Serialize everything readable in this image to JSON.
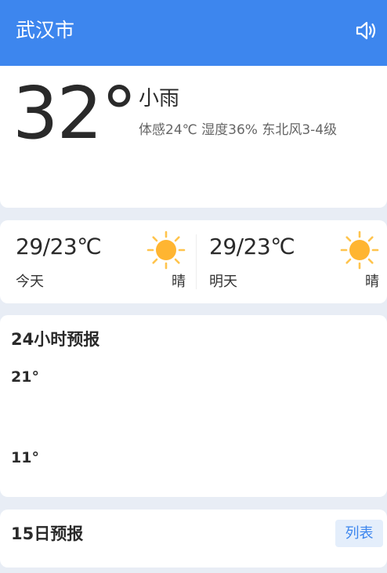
{
  "header": {
    "city": "武汉市",
    "speaker_icon": "speaker-icon"
  },
  "current": {
    "temperature": "32°",
    "condition": "小雨",
    "details": "体感24℃ 湿度36% 东北风3-4级"
  },
  "daily": [
    {
      "label": "今天",
      "range": "29/23℃",
      "weather": "晴",
      "icon": "sun-icon"
    },
    {
      "label": "明天",
      "range": "29/23℃",
      "weather": "晴",
      "icon": "sun-icon"
    }
  ],
  "hourly": {
    "title": "24小时预报",
    "ymax": "21°",
    "ymin": "11°"
  },
  "fifteen_day": {
    "title": "15日预报",
    "list_button": "列表"
  },
  "colors": {
    "header_bg": "#3d86ee",
    "page_bg": "#e8edf5",
    "sun_fill": "#ffb531",
    "sun_ray": "#ffc44d",
    "button_bg": "#e4eefb",
    "button_text": "#3d86ee"
  }
}
